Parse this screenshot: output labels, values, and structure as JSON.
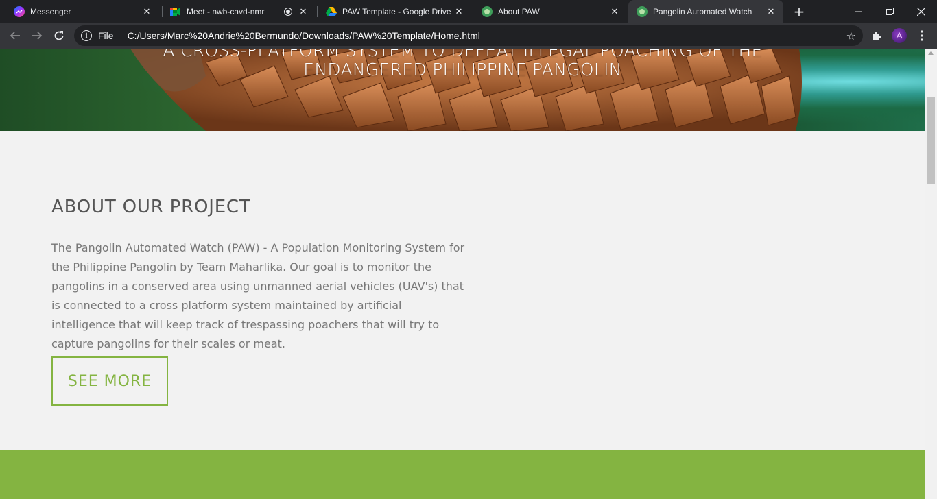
{
  "browser": {
    "tabs": [
      {
        "title": "Messenger",
        "icon": "messenger-icon"
      },
      {
        "title": "Meet - nwb-cavd-nmr",
        "icon": "meet-icon",
        "recording": true
      },
      {
        "title": "PAW Template - Google Drive",
        "icon": "google-drive-icon"
      },
      {
        "title": "About PAW",
        "icon": "paw-logo-icon"
      },
      {
        "title": "Pangolin Automated Watch",
        "icon": "paw-logo-icon",
        "active": true
      }
    ],
    "omnibox": {
      "scheme_label": "File",
      "url": "C:/Users/Marc%20Andrie%20Bermundo/Downloads/PAW%20Template/Home.html"
    }
  },
  "hero": {
    "line1": "A CROSS-PLATFORM SYSTEM TO DEFEAT ILLEGAL POACHING OF THE",
    "line2": "ENDANGERED PHILIPPINE PANGOLIN"
  },
  "about": {
    "title": "ABOUT OUR PROJECT",
    "body": "The Pangolin Automated Watch (PAW) - A Population Monitoring System for the Philippine Pangolin by Team Maharlika. Our goal is to monitor the pangolins in a conserved area using unmanned aerial vehicles (UAV's) that is connected to a cross platform system maintained by artificial intelligence that will keep track of trespassing poachers that will try to capture pangolins for their scales or meat.",
    "button_label": "SEE MORE"
  },
  "colors": {
    "accent_green": "#84b441",
    "chrome_dark": "#202124",
    "chrome_toolbar": "#35363a",
    "page_bg": "#f2f2f2"
  }
}
